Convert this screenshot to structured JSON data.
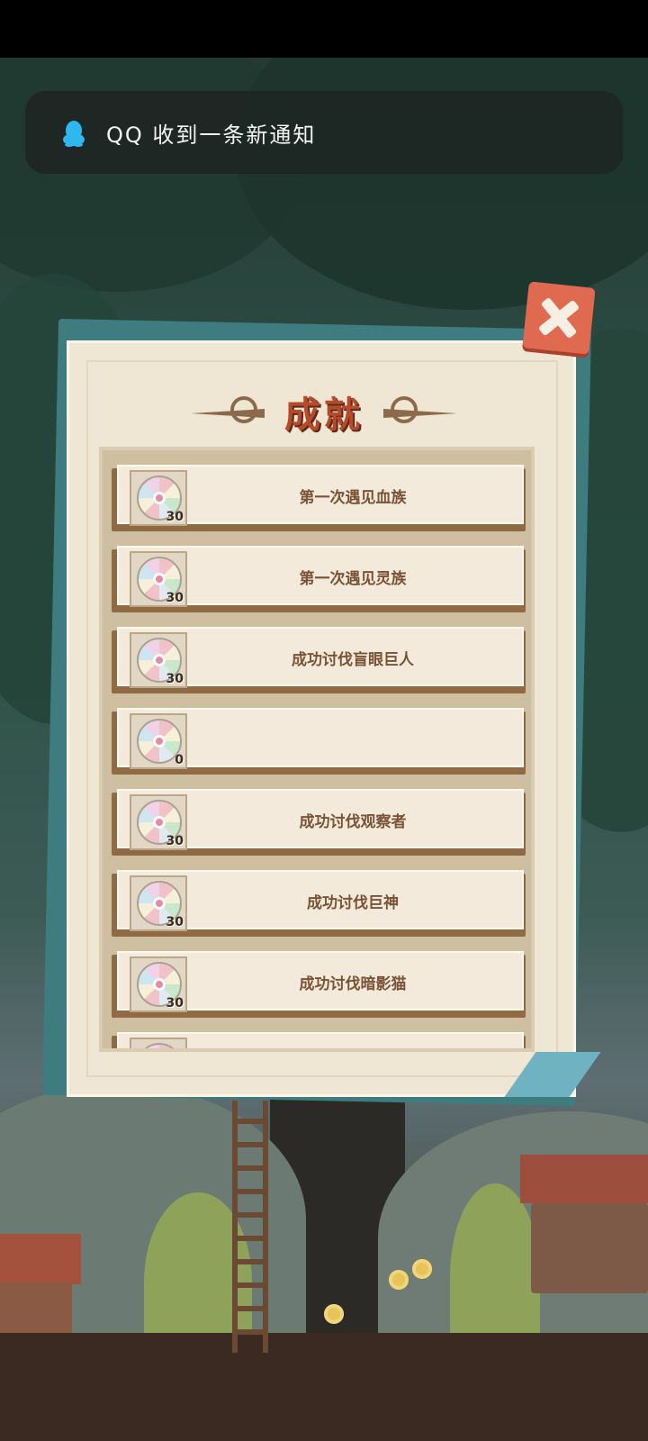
{
  "notification": {
    "app": "QQ",
    "text": "QQ 收到一条新通知",
    "icon": "qq-penguin-icon",
    "accent": "#2fb8f0"
  },
  "dialog": {
    "title": "成就",
    "close_icon": "close-x-icon",
    "rewards_icon": "rainbow-gem-icon",
    "items": [
      {
        "label": "第一次遇见血族",
        "count": "30"
      },
      {
        "label": "第一次遇见灵族",
        "count": "30"
      },
      {
        "label": "成功讨伐盲眼巨人",
        "count": "30"
      },
      {
        "label": "",
        "count": "0"
      },
      {
        "label": "成功讨伐观察者",
        "count": "30"
      },
      {
        "label": "成功讨伐巨神",
        "count": "30"
      },
      {
        "label": "成功讨伐暗影猫",
        "count": "30"
      },
      {
        "label": "",
        "count": ""
      }
    ]
  },
  "colors": {
    "title": "#b84a2c",
    "panel": "#efe6d3",
    "close_button": "#e06a4f",
    "row_text": "#7a5236"
  }
}
